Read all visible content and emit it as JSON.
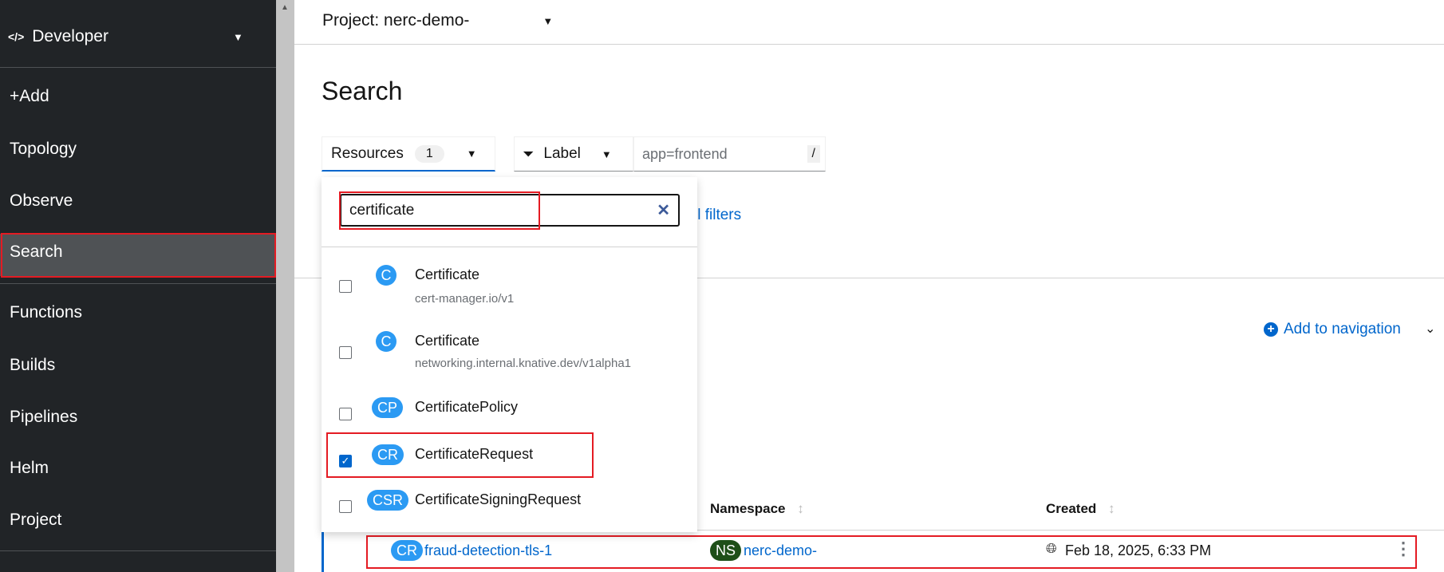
{
  "sidebar": {
    "perspective": "Developer",
    "items": [
      {
        "label": "+Add"
      },
      {
        "label": "Topology"
      },
      {
        "label": "Observe"
      },
      {
        "label": "Search",
        "active": true
      },
      {
        "label": "Functions"
      },
      {
        "label": "Builds"
      },
      {
        "label": "Pipelines"
      },
      {
        "label": "Helm"
      },
      {
        "label": "Project"
      }
    ]
  },
  "header": {
    "project": "Project: nerc-demo-"
  },
  "page": {
    "title": "Search"
  },
  "filters": {
    "resources_label": "Resources",
    "resources_count": "1",
    "label_toggle": "Label",
    "label_placeholder": "app=frontend",
    "shortcut": "/",
    "clear_all": "ll filters"
  },
  "dropdown": {
    "search_value": "certificate",
    "items": [
      {
        "abbr": "C",
        "name": "Certificate",
        "group": "cert-manager.io/v1",
        "checked": false
      },
      {
        "abbr": "C",
        "name": "Certificate",
        "group": "networking.internal.knative.dev/v1alpha1",
        "checked": false
      },
      {
        "abbr": "CP",
        "name": "CertificatePolicy",
        "checked": false
      },
      {
        "abbr": "CR",
        "name": "CertificateRequest",
        "checked": true
      },
      {
        "abbr": "CSR",
        "name": "CertificateSigningRequest",
        "checked": false
      }
    ]
  },
  "add_to_navigation": "Add to navigation",
  "table": {
    "columns": [
      "Namespace",
      "Created"
    ],
    "rows": [
      {
        "kind": "CR",
        "name": "fraud-detection-tls-1",
        "ns_badge": "NS",
        "namespace": "nerc-demo-",
        "created": "Feb 18, 2025, 6:33 PM"
      }
    ]
  },
  "colors": {
    "accent": "#0066cc",
    "resource_badge": "#2b9af3",
    "namespace_badge": "#1e4f18",
    "highlight": "#e41b23",
    "sidebar": "#212427"
  }
}
